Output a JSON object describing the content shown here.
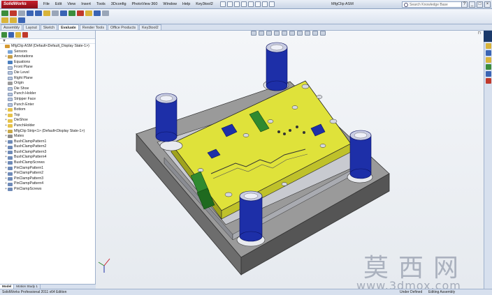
{
  "app": {
    "logo_text": "SolidWorks",
    "document_title": "MfgClip ASM",
    "menu": [
      "File",
      "Edit",
      "View",
      "Insert",
      "Tools",
      "3Dconfig",
      "PhotoView 360",
      "Window",
      "Help",
      "Key3tool2"
    ],
    "search_placeholder": "Search Knowledge Base",
    "window_buttons": [
      "?",
      "_",
      "□",
      "×"
    ]
  },
  "command_tabs": [
    {
      "label": "Assembly",
      "active": false
    },
    {
      "label": "Layout",
      "active": false
    },
    {
      "label": "Sketch",
      "active": false
    },
    {
      "label": "Evaluate",
      "active": true
    },
    {
      "label": "Render Tools",
      "active": false
    },
    {
      "label": "Office Products",
      "active": false
    },
    {
      "label": "Key3tool2",
      "active": false
    }
  ],
  "tree": {
    "filter_icon": "filter-icon",
    "items": [
      {
        "label": "MfgClip ASM  (Default<Default_Display State-1>)",
        "icon": "asm",
        "expander": "",
        "indent": 0
      },
      {
        "label": "Sensors",
        "icon": "sensor",
        "expander": "",
        "indent": 1
      },
      {
        "label": "Annotations",
        "icon": "annot",
        "expander": "+",
        "indent": 1
      },
      {
        "label": "Equations",
        "icon": "eq",
        "expander": "",
        "indent": 1
      },
      {
        "label": "Front Plane",
        "icon": "plane",
        "expander": "",
        "indent": 1
      },
      {
        "label": "Die Level",
        "icon": "plane",
        "expander": "",
        "indent": 1
      },
      {
        "label": "Right Plane",
        "icon": "plane",
        "expander": "",
        "indent": 1
      },
      {
        "label": "Origin",
        "icon": "origin",
        "expander": "",
        "indent": 1
      },
      {
        "label": "Die Shoe",
        "icon": "plane",
        "expander": "",
        "indent": 1
      },
      {
        "label": "Punch Holder",
        "icon": "plane",
        "expander": "",
        "indent": 1
      },
      {
        "label": "Stripper Face",
        "icon": "plane",
        "expander": "",
        "indent": 1
      },
      {
        "label": "Punch Enter",
        "icon": "plane",
        "expander": "",
        "indent": 1
      },
      {
        "label": "Bottom",
        "icon": "folder",
        "expander": "+",
        "indent": 1
      },
      {
        "label": "Top",
        "icon": "folder",
        "expander": "+",
        "indent": 1
      },
      {
        "label": "DieShoe",
        "icon": "folder",
        "expander": "+",
        "indent": 1
      },
      {
        "label": "PunchHolder",
        "icon": "folder",
        "expander": "+",
        "indent": 1
      },
      {
        "label": "MfgClip Strip<1> (Default<Display State-1>)",
        "icon": "part",
        "expander": "+",
        "indent": 1
      },
      {
        "label": "Mates",
        "icon": "mates",
        "expander": "+",
        "indent": 1
      },
      {
        "label": "BushClampPattern1",
        "icon": "pattern",
        "expander": "+",
        "indent": 1
      },
      {
        "label": "BushClampPattern2",
        "icon": "pattern",
        "expander": "+",
        "indent": 1
      },
      {
        "label": "BushClampPattern3",
        "icon": "pattern",
        "expander": "+",
        "indent": 1
      },
      {
        "label": "BushClampPattern4",
        "icon": "pattern",
        "expander": "+",
        "indent": 1
      },
      {
        "label": "BushClampScrews",
        "icon": "pattern",
        "expander": "+",
        "indent": 1
      },
      {
        "label": "PinClampPattern1",
        "icon": "pattern",
        "expander": "+",
        "indent": 1
      },
      {
        "label": "PinClampPattern2",
        "icon": "pattern",
        "expander": "+",
        "indent": 1
      },
      {
        "label": "PinClampPattern3",
        "icon": "pattern",
        "expander": "+",
        "indent": 1
      },
      {
        "label": "PinClampPattern4",
        "icon": "pattern",
        "expander": "+",
        "indent": 1
      },
      {
        "label": "PinClampScrews",
        "icon": "pattern",
        "expander": "+",
        "indent": 1
      }
    ]
  },
  "panel_tabs": [
    {
      "label": "Model",
      "active": true
    },
    {
      "label": "Motion Study 1",
      "active": false
    }
  ],
  "status": {
    "left": "SolidWorks Professional 2011 x64 Edition",
    "mid": "Under Defined",
    "right": "Editing Assembly"
  },
  "watermark": {
    "cn": "莫西网",
    "url": "www.3dmox.com"
  },
  "colors": {
    "plate_yellow": "#dfe23a",
    "plate_gray": "#8f8f8f",
    "bushing_blue": "#1d2fa8",
    "clip_green": "#2f8a2f",
    "accent_red": "#c8202c"
  }
}
